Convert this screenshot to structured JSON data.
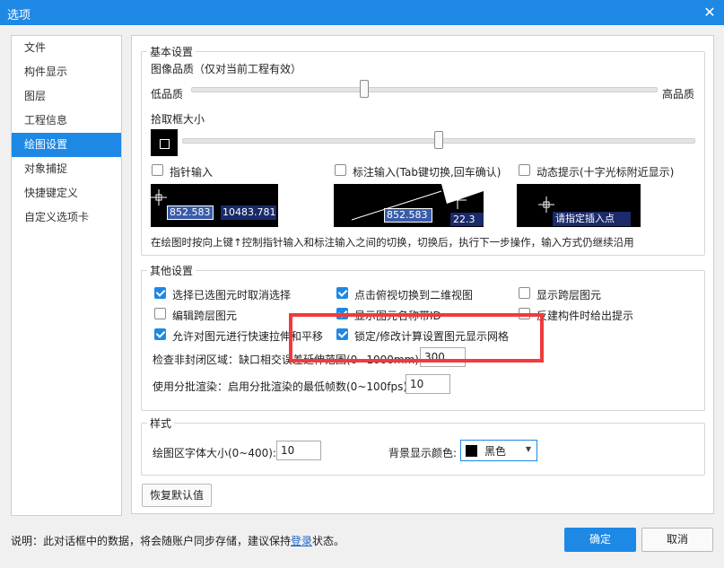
{
  "window": {
    "title": "选项",
    "close_glyph": "✕"
  },
  "sidebar": {
    "items": [
      {
        "label": "文件"
      },
      {
        "label": "构件显示"
      },
      {
        "label": "图层"
      },
      {
        "label": "工程信息"
      },
      {
        "label": "绘图设置",
        "active": true
      },
      {
        "label": "对象捕捉"
      },
      {
        "label": "快捷键定义"
      },
      {
        "label": "自定义选项卡"
      }
    ]
  },
  "basic": {
    "legend": "基本设置",
    "image_quality_label": "图像品质（仅对当前工程有效）",
    "low_label": "低品质",
    "high_label": "高品质",
    "image_quality_level": 0.42,
    "pickbox_label": "拾取框大小",
    "pickbox_level": 0.49,
    "pointer_input_label": "指针输入",
    "dim_input_label": "标注输入(Tab键切换,回车确认)",
    "dynamic_hint_label": "动态提示(十字光标附近显示)",
    "preview1_val1": "852.583",
    "preview1_val2": "10483.781",
    "preview2_val1": "852.583",
    "preview2_val2": "22.3",
    "preview3_text": "请指定插入点",
    "description": "在绘图时按向上键↑控制指针输入和标注输入之间的切换，切换后，执行下一步操作，输入方式仍继续沿用"
  },
  "other": {
    "legend": "其他设置",
    "checkboxes": [
      {
        "label": "选择已选图元时取消选择",
        "checked": true
      },
      {
        "label": "点击俯视切换到二维视图",
        "checked": true
      },
      {
        "label": "显示跨层图元",
        "checked": false
      },
      {
        "label": "编辑跨层图元",
        "checked": false
      },
      {
        "label": "显示图元名称带ID",
        "checked": true
      },
      {
        "label": "反建构件时给出提示",
        "checked": false
      },
      {
        "label": "允许对图元进行快速拉伸和平移",
        "checked": true
      },
      {
        "label": "锁定/修改计算设置图元显示网格",
        "checked": true
      }
    ],
    "gap_label": "检查非封闭区域：缺口相交误差延伸范围(0~1000mm):",
    "gap_value": "300",
    "batch_label": "使用分批渲染：启用分批渲染的最低帧数(0~100fps):",
    "batch_value": "10"
  },
  "style": {
    "legend": "样式",
    "font_size_label": "绘图区字体大小(0~400):",
    "font_size_value": "10",
    "bg_color_label": "背景显示颜色:",
    "bg_color_value": "黑色",
    "bg_color_hex": "#000000"
  },
  "buttons": {
    "restore_defaults": "恢复默认值",
    "ok": "确定",
    "cancel": "取消"
  },
  "footer": {
    "note_prefix": "说明：此对话框中的数据，将会随账户同步存储，建议保持",
    "note_link": "登录",
    "note_suffix": "状态。"
  },
  "colors": {
    "accent": "#1e88e5",
    "highlight_box": "#ef3b3b"
  }
}
